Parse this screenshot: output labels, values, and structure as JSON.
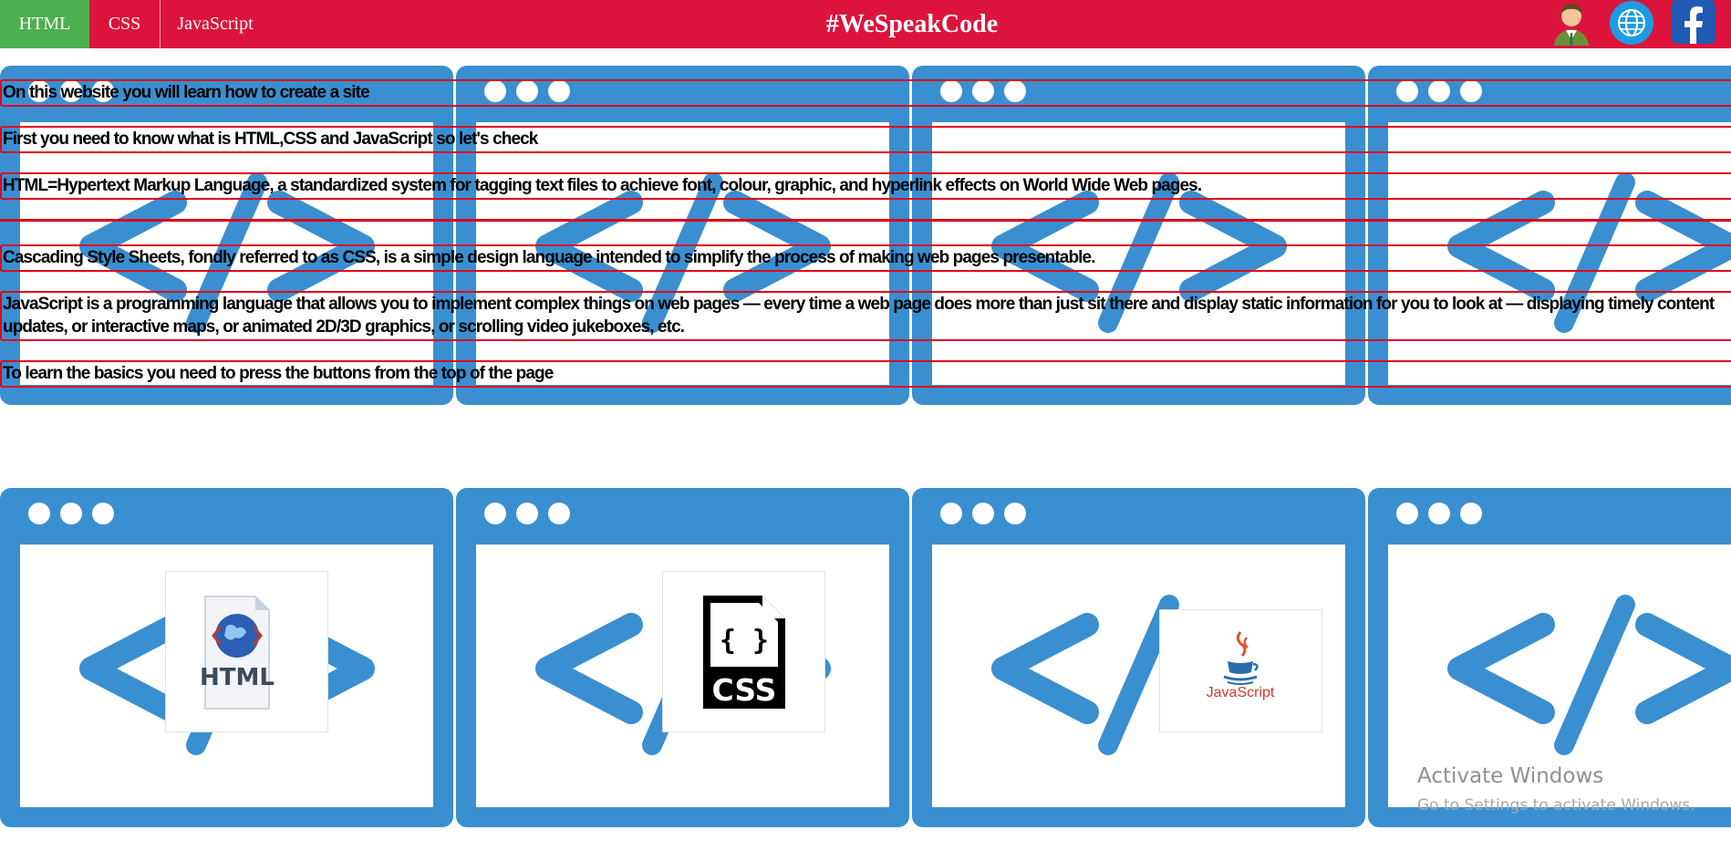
{
  "nav": {
    "tabs": [
      {
        "label": "HTML",
        "active": true
      },
      {
        "label": "CSS",
        "active": false
      },
      {
        "label": "JavaScript",
        "active": false
      }
    ],
    "brand": "#WeSpeakCode",
    "icons": [
      "user-avatar-icon",
      "globe-icon",
      "facebook-icon"
    ]
  },
  "intro": {
    "lines": [
      "On this website you will learn how to create a site",
      "First you need to know what is HTML,CSS and JavaScript so let's check",
      "HTML=Hypertext Markup Language, a standardized system for tagging text files to achieve font, colour, graphic, and hyperlink effects on World Wide Web pages.",
      "Cascading Style Sheets, fondly referred to as CSS, is a simple design language intended to simplify the process of making web pages presentable.",
      "JavaScript is a programming language that allows you to implement complex things on web pages — every time a web page does more than just sit there and display static information for you to look at — displaying timely content updates, or interactive maps, or animated 2D/3D graphics, or scrolling video jukeboxes, etc.",
      "To learn the basics you need to press the buttons from the top of the page"
    ]
  },
  "background_tile": {
    "glyph": "</>",
    "color": "#3a8fd0",
    "icon": "code-window-icon"
  },
  "logos": {
    "html": {
      "label": "HTML",
      "icon": "html-file-icon"
    },
    "css": {
      "label": "CSS",
      "icon": "css-file-icon"
    },
    "javascript": {
      "label": "JavaScript",
      "icon": "java-cup-icon"
    }
  },
  "watermark": {
    "title": "Activate Windows",
    "subtitle": "Go to Settings to activate Windows."
  },
  "colors": {
    "nav_bg": "#dc143c",
    "active_tab": "#4caf50",
    "tile_blue": "#3a8fd0",
    "strip_border": "#e0001b"
  }
}
